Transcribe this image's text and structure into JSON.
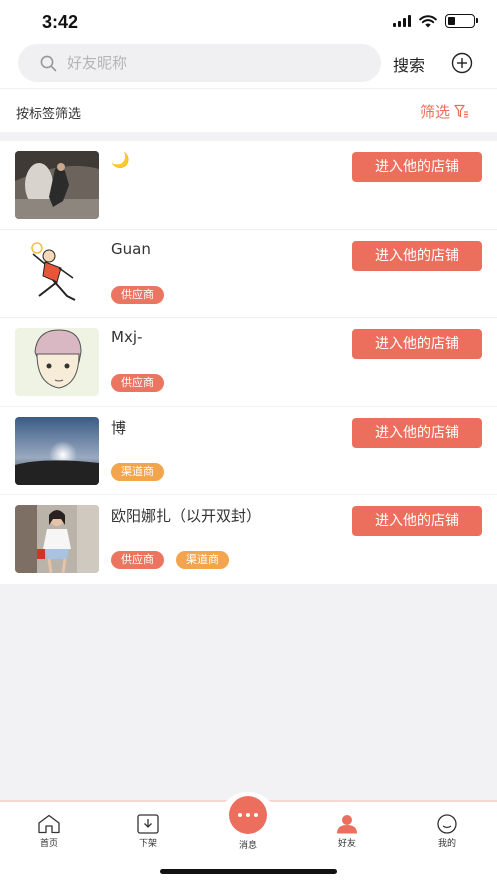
{
  "status_bar": {
    "time": "3:42"
  },
  "search": {
    "placeholder": "好友昵称",
    "search_label": "搜索"
  },
  "filter": {
    "label": "按标签筛选",
    "button_label": "筛选"
  },
  "friends": [
    {
      "name": "🌙",
      "tags": [],
      "button": "进入他的店铺"
    },
    {
      "name": "Guan",
      "tags": [
        {
          "label": "供应商",
          "type": "supplier"
        }
      ],
      "button": "进入他的店铺"
    },
    {
      "name": "Mxj-",
      "tags": [
        {
          "label": "供应商",
          "type": "supplier"
        }
      ],
      "button": "进入他的店铺"
    },
    {
      "name": "博",
      "tags": [
        {
          "label": "渠道商",
          "type": "channel"
        }
      ],
      "button": "进入他的店铺"
    },
    {
      "name": "欧阳娜扎（以开双封）",
      "tags": [
        {
          "label": "供应商",
          "type": "supplier"
        },
        {
          "label": "渠道商",
          "type": "channel"
        }
      ],
      "button": "进入他的店铺"
    }
  ],
  "tabbar": {
    "home": "首页",
    "shelf": "下架",
    "messages": "消息",
    "friends": "好友",
    "mine": "我的"
  },
  "colors": {
    "accent": "#ec6f5e",
    "supplier": "#ec7562",
    "channel": "#f2a54c"
  }
}
